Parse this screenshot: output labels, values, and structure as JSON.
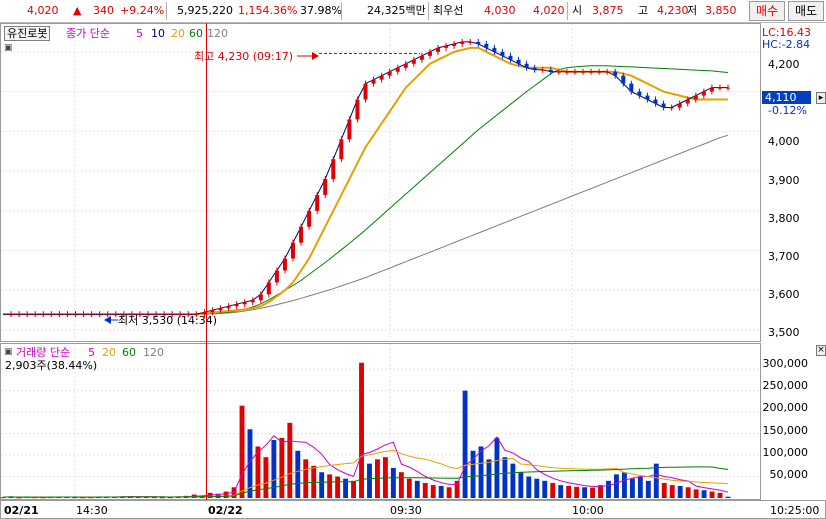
{
  "header": {
    "price": "4,020",
    "change_arrow": "▲",
    "change": "340",
    "change_pct": "+9.24%",
    "volume": "5,925,220",
    "volume_ratio": "1,154.36%",
    "turnover": "37.98%",
    "trade_value": "24,325백만",
    "best_ask_label": "최우선",
    "best_ask": "4,030",
    "best_bid": "4,020",
    "open_label": "시",
    "open": "3,875",
    "high_label": "고",
    "high": "4,230",
    "low_label": "저",
    "low": "3,850",
    "buy_label": "매수",
    "sell_label": "매도"
  },
  "price_panel": {
    "stock_name": "유진로봇",
    "legend_prefix": "종가 단순",
    "ma_periods": [
      "5",
      "10",
      "20",
      "60",
      "120"
    ],
    "lc_label": "LC:16.43",
    "hc_label": "HC:-2.84",
    "high_annotation": "최고 4,230 (09:17)",
    "low_annotation": "최저 3,530 (14:34)",
    "current_price_tag": "4,110",
    "current_change_tag": "-0.12%",
    "y_ticks": [
      "4,200",
      "4,100",
      "4,000",
      "3,900",
      "3,800",
      "3,700",
      "3,600",
      "3,500"
    ]
  },
  "volume_panel": {
    "title": "거래량 단순",
    "ma_periods": [
      "5",
      "20",
      "60",
      "120"
    ],
    "current": "2,903주(38.44%)",
    "y_ticks": [
      "300,000",
      "250,000",
      "200,000",
      "150,000",
      "100,000",
      "50,000"
    ]
  },
  "x_axis": {
    "labels": [
      "02/21",
      "14:30",
      "02/22",
      "09:30",
      "10:00",
      "10:25:00"
    ]
  },
  "colors": {
    "up": "#e00000",
    "down": "#0032c8",
    "ma5": "#cc00cc",
    "ma10": "#000080",
    "ma20": "#e8a000",
    "ma60": "#008000",
    "ma120": "#808080"
  },
  "chart_data": {
    "type": "line",
    "price": {
      "close": [
        3540,
        3540,
        3540,
        3540,
        3540,
        3540,
        3540,
        3540,
        3540,
        3540,
        3540,
        3540,
        3540,
        3540,
        3540,
        3540,
        3540,
        3540,
        3540,
        3540,
        3540,
        3540,
        3540,
        3540,
        3540,
        3545,
        3550,
        3555,
        3560,
        3565,
        3570,
        3575,
        3590,
        3620,
        3650,
        3680,
        3720,
        3760,
        3800,
        3840,
        3880,
        3930,
        3980,
        4030,
        4080,
        4120,
        4130,
        4140,
        4150,
        4160,
        4170,
        4180,
        4190,
        4200,
        4210,
        4215,
        4220,
        4225,
        4225,
        4220,
        4210,
        4200,
        4190,
        4180,
        4170,
        4160,
        4155,
        4155,
        4150,
        4150,
        4150,
        4150,
        4150,
        4150,
        4150,
        4150,
        4140,
        4120,
        4100,
        4090,
        4080,
        4070,
        4060,
        4060,
        4070,
        4080,
        4090,
        4100,
        4110,
        4110,
        4110
      ],
      "ma20": [
        3540,
        3540,
        3540,
        3540,
        3540,
        3540,
        3540,
        3540,
        3540,
        3540,
        3540,
        3540,
        3540,
        3540,
        3540,
        3540,
        3540,
        3540,
        3540,
        3540,
        3540,
        3540,
        3540,
        3540,
        3540,
        3542,
        3544,
        3546,
        3548,
        3550,
        3552,
        3555,
        3560,
        3570,
        3585,
        3600,
        3620,
        3650,
        3680,
        3720,
        3760,
        3800,
        3840,
        3880,
        3920,
        3960,
        3990,
        4020,
        4050,
        4080,
        4110,
        4130,
        4150,
        4170,
        4180,
        4190,
        4200,
        4205,
        4210,
        4210,
        4200,
        4190,
        4180,
        4170,
        4165,
        4160,
        4160,
        4160,
        4160,
        4155,
        4150,
        4150,
        4150,
        4150,
        4150,
        4150,
        4150,
        4145,
        4140,
        4130,
        4120,
        4110,
        4100,
        4095,
        4090,
        4085,
        4080,
        4080,
        4080,
        4080,
        4080
      ],
      "ma60": [
        3540,
        3540,
        3540,
        3540,
        3540,
        3540,
        3540,
        3540,
        3540,
        3540,
        3540,
        3540,
        3540,
        3540,
        3540,
        3540,
        3540,
        3540,
        3540,
        3540,
        3540,
        3540,
        3540,
        3540,
        3540,
        3541,
        3542,
        3543,
        3545,
        3548,
        3552,
        3558,
        3566,
        3576,
        3588,
        3600,
        3612,
        3625,
        3640,
        3655,
        3670,
        3686,
        3702,
        3718,
        3735,
        3752,
        3770,
        3788,
        3806,
        3824,
        3842,
        3860,
        3878,
        3896,
        3914,
        3932,
        3950,
        3968,
        3986,
        4004,
        4020,
        4036,
        4052,
        4068,
        4084,
        4100,
        4115,
        4130,
        4145,
        4155,
        4160,
        4162,
        4164,
        4165,
        4165,
        4165,
        4164,
        4163,
        4162,
        4161,
        4160,
        4159,
        4158,
        4157,
        4156,
        4155,
        4154,
        4153,
        4152,
        4150,
        4148
      ],
      "ma120": [
        3540,
        3540,
        3540,
        3540,
        3540,
        3540,
        3540,
        3540,
        3540,
        3540,
        3540,
        3540,
        3540,
        3540,
        3540,
        3540,
        3540,
        3540,
        3540,
        3540,
        3540,
        3540,
        3540,
        3540,
        3540,
        3540,
        3541,
        3542,
        3543,
        3545,
        3548,
        3551,
        3555,
        3559,
        3564,
        3569,
        3574,
        3580,
        3586,
        3592,
        3598,
        3604,
        3611,
        3618,
        3625,
        3632,
        3640,
        3648,
        3656,
        3664,
        3672,
        3680,
        3688,
        3696,
        3704,
        3712,
        3720,
        3728,
        3736,
        3744,
        3752,
        3760,
        3768,
        3776,
        3784,
        3792,
        3800,
        3808,
        3816,
        3824,
        3832,
        3840,
        3848,
        3856,
        3864,
        3872,
        3880,
        3888,
        3896,
        3904,
        3912,
        3920,
        3928,
        3936,
        3944,
        3952,
        3960,
        3968,
        3976,
        3984,
        3990
      ]
    },
    "volume": [
      2000,
      3000,
      1500,
      2500,
      2000,
      1800,
      2200,
      3000,
      2500,
      2000,
      1800,
      2000,
      2500,
      3000,
      2800,
      3500,
      4000,
      3000,
      2500,
      2000,
      1800,
      2000,
      3000,
      5000,
      8000,
      6000,
      12000,
      10000,
      15000,
      25000,
      215000,
      160000,
      120000,
      95000,
      135000,
      140000,
      175000,
      110000,
      90000,
      75000,
      60000,
      55000,
      50000,
      45000,
      40000,
      315000,
      80000,
      90000,
      95000,
      70000,
      60000,
      45000,
      40000,
      35000,
      30000,
      28000,
      25000,
      40000,
      250000,
      110000,
      120000,
      90000,
      140000,
      95000,
      80000,
      60000,
      50000,
      45000,
      40000,
      35000,
      30000,
      28000,
      26000,
      25000,
      24000,
      30000,
      40000,
      55000,
      60000,
      45000,
      50000,
      40000,
      80000,
      35000,
      30000,
      28000,
      25000,
      20000,
      18000,
      15000,
      12000,
      3000
    ],
    "y_range_price": [
      3480,
      4260
    ],
    "y_range_volume": [
      0,
      340000
    ]
  }
}
